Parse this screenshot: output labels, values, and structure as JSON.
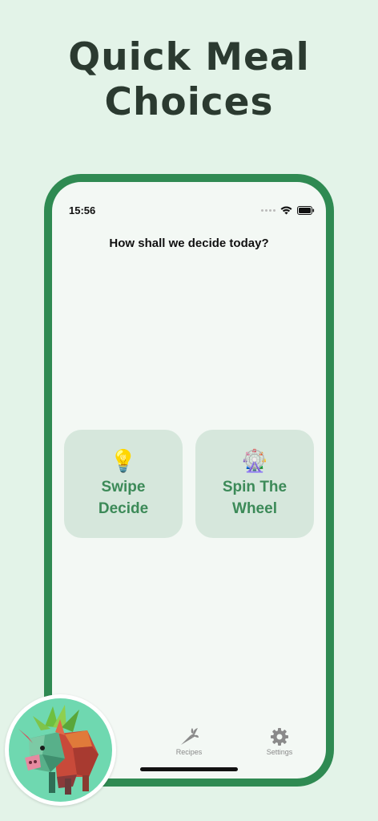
{
  "headline": {
    "line1": "Quick Meal",
    "line2": "Choices"
  },
  "status_bar": {
    "time": "15:56"
  },
  "main": {
    "question": "How shall we decide today?",
    "options": [
      {
        "icon": "lightbulb-icon",
        "emoji": "💡",
        "label_line1": "Swipe",
        "label_line2": "Decide"
      },
      {
        "icon": "ferris-wheel-icon",
        "emoji": "🎡",
        "label_line1": "Spin The",
        "label_line2": "Wheel"
      }
    ]
  },
  "tab_bar": {
    "items": [
      {
        "label": "Recipes",
        "icon": "carrot-icon"
      },
      {
        "label": "Settings",
        "icon": "gear-icon"
      }
    ]
  },
  "colors": {
    "background": "#e3f3e8",
    "frame": "#2f8a52",
    "screen": "#f3f8f4",
    "card": "#d6e7dc",
    "accent_text": "#3c8a58",
    "headline": "#2b3a30"
  },
  "mascot": {
    "icon": "lowpoly-pig-mascot-icon"
  }
}
